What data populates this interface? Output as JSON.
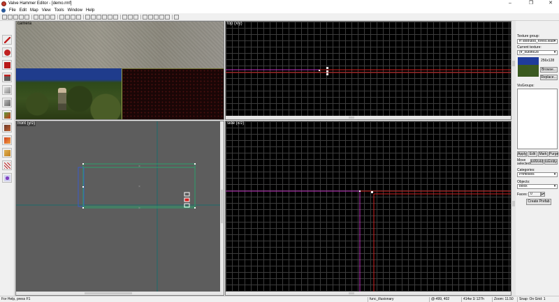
{
  "window": {
    "title": "Valve Hammer Editor - [demo.rmf]",
    "minimize_glyph": "–",
    "restore_glyph": "❐",
    "close_glyph": "✕"
  },
  "menu": [
    "File",
    "Edit",
    "Map",
    "View",
    "Tools",
    "Window",
    "Help"
  ],
  "viewports": {
    "camera": "camera",
    "top": "top (x/y)",
    "front": "front (y/z)",
    "side": "side (x/z)"
  },
  "right_panel": {
    "texture_group_label": "Texture group:",
    "texture_group_value": "fr:\\dod\\dod_forest.wad",
    "current_texture_label": "Current texture:",
    "current_texture_value": "{fr_outline2b",
    "texture_size": "256x128",
    "browse_button": "Browse...",
    "replace_button": "Replace...",
    "visgroups_label": "VisGroups:",
    "apply_button": "Apply",
    "edit_button": "Edit",
    "mark_button": "Mark",
    "purge_button": "Purge",
    "move_selected_label": "Move selected:",
    "to_world_button": "toWorld",
    "to_entity_button": "toEntity",
    "categories_label": "Categories:",
    "categories_value": "Primitives",
    "objects_label": "Objects:",
    "objects_value": "block",
    "faces_label": "Faces:",
    "faces_value": "0",
    "create_prefab_button": "Create Prefab"
  },
  "status": {
    "help": "For Help, press F1",
    "entity": "func_illusionary",
    "coords": "@-499, 402",
    "size": "414w 1l 127h",
    "zoom": "Zoom: 11.50",
    "snap": "Snap: On Grid: 1"
  },
  "colors": {
    "selection": "#ffffff",
    "brush_green": "#2aa06a",
    "axis_red": "#d02020",
    "axis_magenta": "#c030c0",
    "axis_teal": "#1a6a6a",
    "brush_blue": "#3a5ac8"
  },
  "tools": [
    "selection-tool-icon",
    "magnify-tool-icon",
    "camera-tool-icon",
    "entity-tool-icon",
    "block-tool-icon",
    "texture-tool-icon",
    "apply-texture-icon",
    "decal-tool-icon",
    "clip-tool-icon",
    "vertex-tool-icon",
    "path-tool-icon",
    "overlay-tool-icon"
  ]
}
